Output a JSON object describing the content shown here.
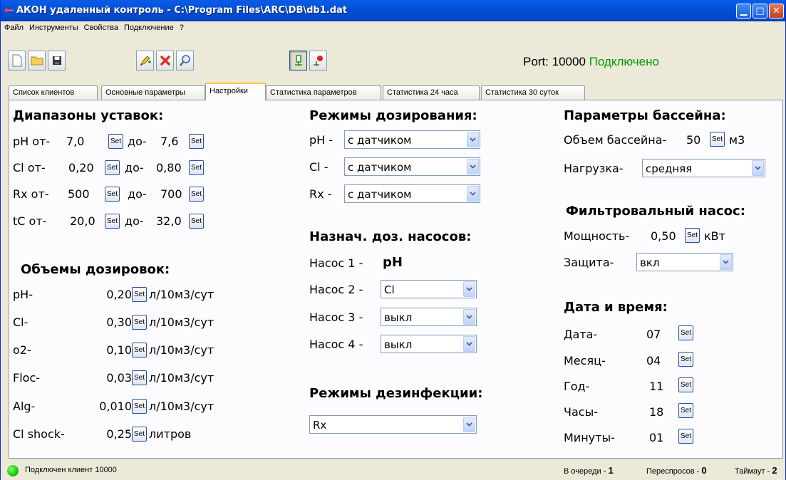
{
  "window": {
    "title": "АКОН удаленный контроль - C:\\Program Files\\ARC\\DB\\db1.dat"
  },
  "menu": [
    "Файл",
    "Инструменты",
    "Свойства",
    "Подключение",
    "?"
  ],
  "toolbar": {
    "port_label": "Port: 10000",
    "connection_status": "Подключено",
    "status_color": "#009a00"
  },
  "tabs": [
    "Список клиентов",
    "Основные параметры",
    "Настройки",
    "Статистика параметров",
    "Статистика 24 часа",
    "Статистика 30 суток"
  ],
  "active_tab": "Настройки",
  "set_label": "Set",
  "ranges": {
    "title": "Диапазоны уставок:",
    "rows": [
      {
        "from_label": "pH от-",
        "from": "7,0",
        "to_label": "до-",
        "to": "7,6"
      },
      {
        "from_label": "Cl от-",
        "from": "0,20",
        "to_label": "до-",
        "to": "0,80"
      },
      {
        "from_label": "Rx от-",
        "from": "500",
        "to_label": "до-",
        "to": "700"
      },
      {
        "from_label": "tC от-",
        "from": "20,0",
        "to_label": "до-",
        "to": "32,0"
      }
    ]
  },
  "doses": {
    "title": "Объемы дозировок:",
    "rows": [
      {
        "label": "pH-",
        "value": "0,20",
        "unit": "л/10м3/сут"
      },
      {
        "label": "Cl-",
        "value": "0,30",
        "unit": "л/10м3/сут"
      },
      {
        "label": "o2-",
        "value": "0,10",
        "unit": "л/10м3/сут"
      },
      {
        "label": "Floc-",
        "value": "0,03",
        "unit": "л/10м3/сут"
      },
      {
        "label": "Alg-",
        "value": "0,010",
        "unit": "л/10м3/сут"
      },
      {
        "label": "Cl shock-",
        "value": "0,25",
        "unit": "литров"
      }
    ]
  },
  "dosing_modes": {
    "title": "Режимы дозирования:",
    "rows": [
      {
        "label": "pH -",
        "value": "с датчиком"
      },
      {
        "label": "Cl -",
        "value": "с датчиком"
      },
      {
        "label": "Rx -",
        "value": "с датчиком"
      }
    ]
  },
  "pumps": {
    "title": "Назнач. доз. насосов:",
    "pump1_label": "Насос 1 -",
    "pump1_value": "pH",
    "rows": [
      {
        "label": "Насос 2 -",
        "value": "Cl"
      },
      {
        "label": "Насос 3 -",
        "value": "выкл"
      },
      {
        "label": "Насос 4 -",
        "value": "выкл"
      }
    ]
  },
  "disinfection": {
    "title": "Режимы дезинфекции:",
    "value": "Rx"
  },
  "pool": {
    "title": "Параметры бассейна:",
    "volume_label": "Объем бассейна-",
    "volume": "50",
    "volume_unit": "м3",
    "load_label": "Нагрузка-",
    "load": "средняя"
  },
  "filter_pump": {
    "title": "Фильтровальный насос:",
    "power_label": "Мощность-",
    "power": "0,50",
    "power_unit": "кВт",
    "protection_label": "Защита-",
    "protection": "вкл"
  },
  "datetime": {
    "title": "Дата и время:",
    "rows": [
      {
        "label": "Дата-",
        "value": "07"
      },
      {
        "label": "Месяц-",
        "value": "04"
      },
      {
        "label": "Год-",
        "value": "11"
      },
      {
        "label": "Часы-",
        "value": "18"
      },
      {
        "label": "Минуты-",
        "value": "01"
      }
    ]
  },
  "status": {
    "client": "Подключен клиент 10000",
    "queue_label": "В очереди -",
    "queue": "1",
    "retries_label": "Переспросов -",
    "retries": "0",
    "timeout_label": "Таймаут -",
    "timeout": "2"
  }
}
